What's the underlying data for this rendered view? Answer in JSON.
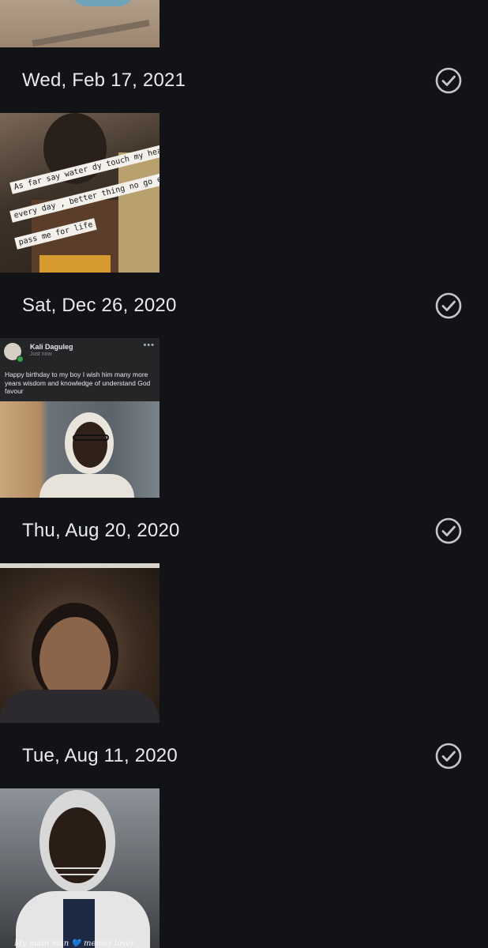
{
  "groups": [
    {
      "date": "Wed, Feb 17, 2021",
      "photo": {
        "caption_lines": [
          "As far say water dy touch my head",
          "every day , better thing no go ever",
          "pass me for life"
        ]
      }
    },
    {
      "date": "Sat, Dec 26, 2020",
      "photo": {
        "post_author": "Kali Daguleg",
        "post_time": "Just now",
        "post_text": "Happy birthday to my boy I wish him many more years wisdom and knowledge of understand God favour"
      }
    },
    {
      "date": "Thu, Aug 20, 2020"
    },
    {
      "date": "Tue, Aug 11, 2020",
      "photo": {
        "caption": "My main man 💙 memer lover"
      }
    }
  ],
  "icons": {
    "select": "check-circle-icon",
    "more": "more-horizontal-icon"
  },
  "colors": {
    "background": "#121317",
    "text": "#e8eaed",
    "icon": "#c4c7c5"
  }
}
